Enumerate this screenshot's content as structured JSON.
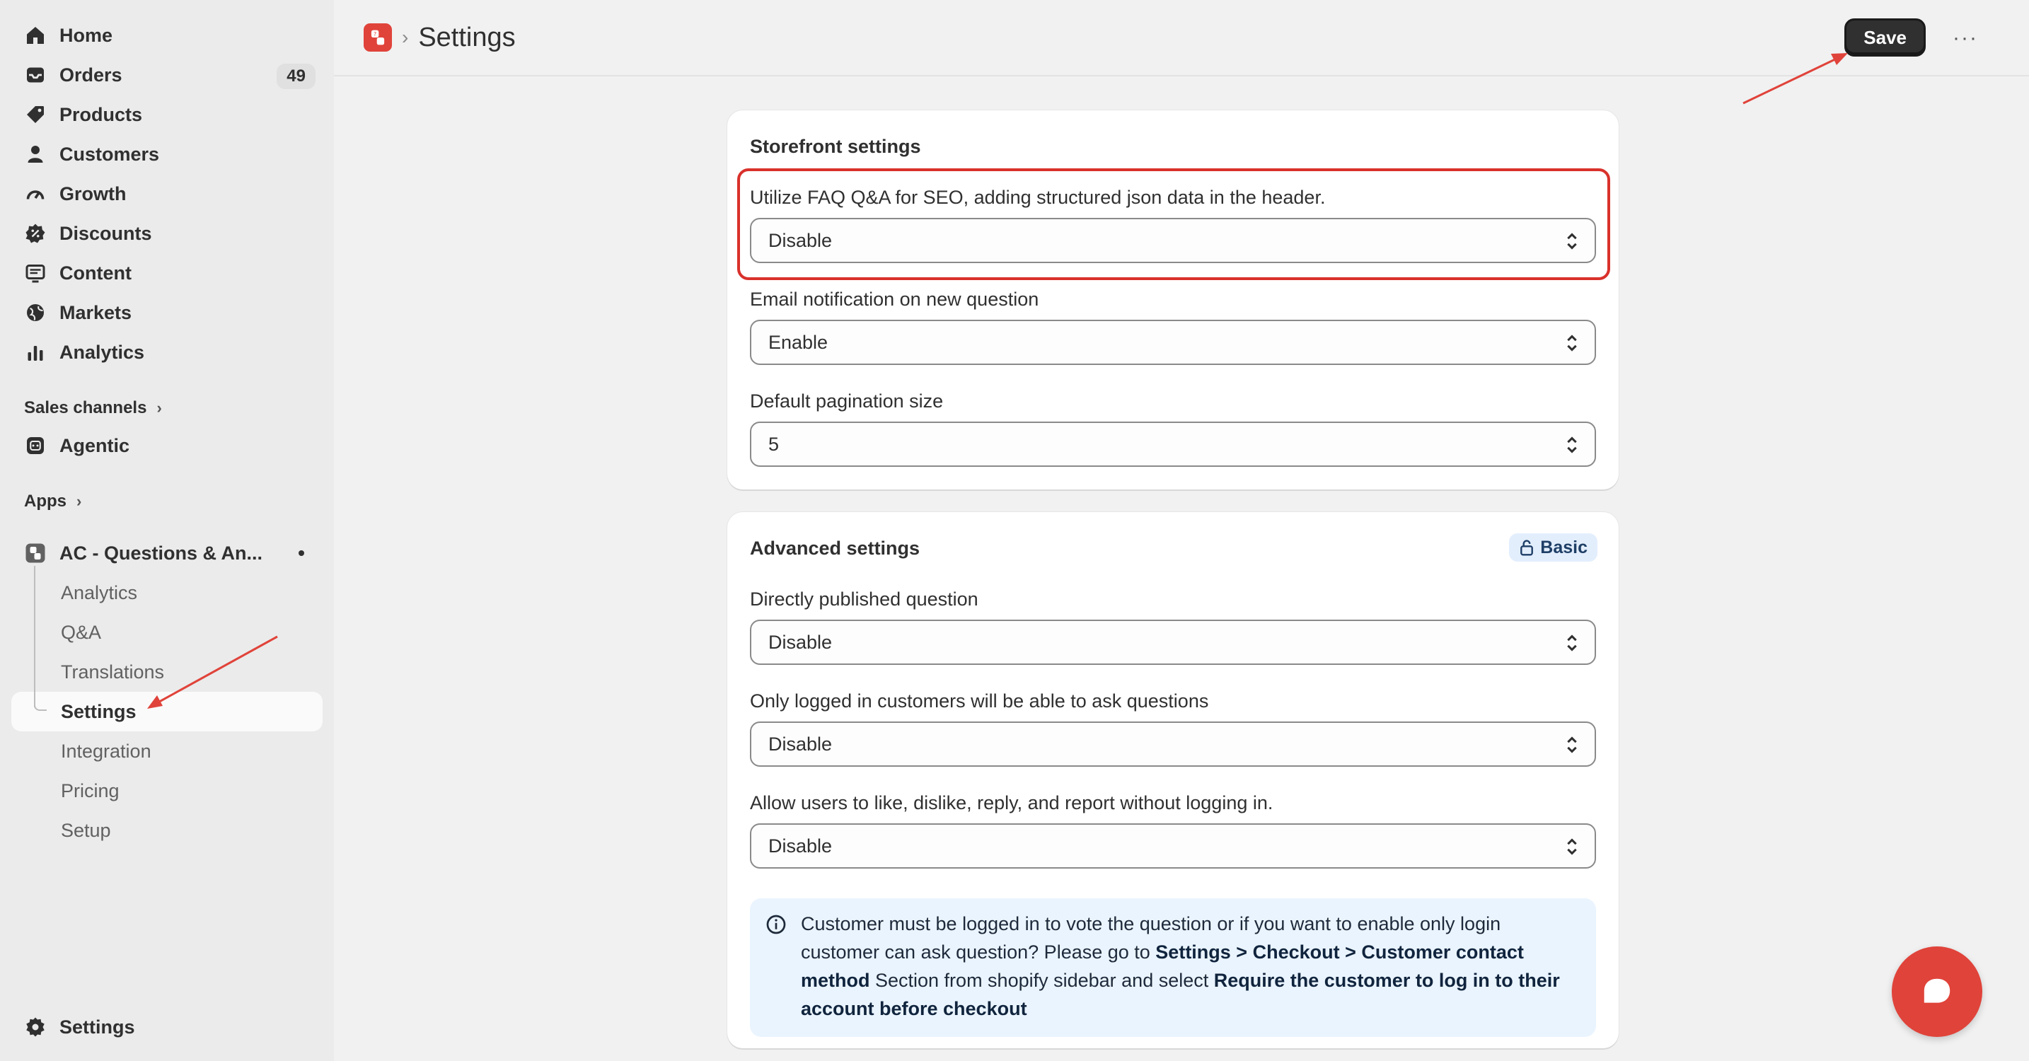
{
  "sidebar": {
    "items": [
      {
        "label": "Home",
        "icon": "home-icon"
      },
      {
        "label": "Orders",
        "icon": "inbox-icon",
        "badge": "49"
      },
      {
        "label": "Products",
        "icon": "tag-icon"
      },
      {
        "label": "Customers",
        "icon": "person-icon"
      },
      {
        "label": "Growth",
        "icon": "gauge-icon"
      },
      {
        "label": "Discounts",
        "icon": "discount-icon"
      },
      {
        "label": "Content",
        "icon": "content-icon"
      },
      {
        "label": "Markets",
        "icon": "globe-icon"
      },
      {
        "label": "Analytics",
        "icon": "bar-chart-icon"
      }
    ],
    "sales_channels_label": "Sales channels",
    "agentic_label": "Agentic",
    "apps_label": "Apps",
    "app_name": "AC - Questions & An...",
    "app_sub_items": [
      {
        "label": "Analytics"
      },
      {
        "label": "Q&A"
      },
      {
        "label": "Translations"
      },
      {
        "label": "Settings"
      },
      {
        "label": "Integration"
      },
      {
        "label": "Pricing"
      },
      {
        "label": "Setup"
      }
    ],
    "settings_label": "Settings"
  },
  "header": {
    "separator": "›",
    "title": "Settings",
    "save_label": "Save",
    "more_label": "···"
  },
  "storefront": {
    "title": "Storefront settings",
    "fields": [
      {
        "label": "Utilize FAQ Q&A for SEO, adding structured json data in the header.",
        "value": "Disable"
      },
      {
        "label": "Email notification on new question",
        "value": "Enable"
      },
      {
        "label": "Default pagination size",
        "value": "5"
      }
    ]
  },
  "advanced": {
    "title": "Advanced settings",
    "plan_badge": "Basic",
    "fields": [
      {
        "label": "Directly published question",
        "value": "Disable"
      },
      {
        "label": "Only logged in customers will be able to ask questions",
        "value": "Disable"
      },
      {
        "label": "Allow users to like, dislike, reply, and report without logging in.",
        "value": "Disable"
      }
    ],
    "info": {
      "part1": "Customer must be logged in to vote the question or if you want to enable only login customer can ask question? Please go to ",
      "bold1": "Settings > Checkout > Customer contact method",
      "part2": " Section from shopify sidebar and select ",
      "bold2": "Require the customer to log in to their account before checkout"
    }
  },
  "colors": {
    "accent_red": "#e0433a",
    "highlight_red": "#d9312b",
    "primary_button": "#303030",
    "info_bg": "#eaf4ff"
  }
}
